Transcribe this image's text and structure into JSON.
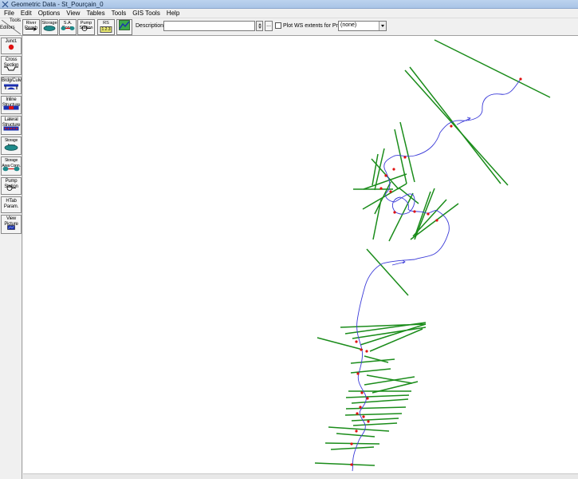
{
  "window": {
    "title": "Geometric Data - St_Pourçain_0"
  },
  "menu": [
    "File",
    "Edit",
    "Options",
    "View",
    "Tables",
    "Tools",
    "GIS Tools",
    "Help"
  ],
  "toolbar": {
    "tools_label": "Tools",
    "editors_label": "Editors",
    "river_reach_label": "River\nReach",
    "storage_area_label": "Storage\nArea",
    "sa_conn_label": "S.A.\nConn.",
    "pump_station_label": "Pump\nStation",
    "rs_label": "RS",
    "rs_badge": "1.2.3",
    "description_label": "Description :",
    "description_value": "",
    "dots_label": "...",
    "plot_ws_label": "Plot WS extents for Profile:",
    "profile_value": "(none)"
  },
  "palette": [
    {
      "key": "junct",
      "label": "Junct."
    },
    {
      "key": "cross_section",
      "label": "Cross\nSection"
    },
    {
      "key": "brdg_culv",
      "label": "Brdg/Culv"
    },
    {
      "key": "inline_structure",
      "label": "Inline\nStructure"
    },
    {
      "key": "lateral_structure",
      "label": "Lateral\nStructure"
    },
    {
      "key": "storage_area",
      "label": "Storage\nArea"
    },
    {
      "key": "storage_area_conn",
      "label": "Storage\nArea Conn."
    },
    {
      "key": "pump_station",
      "label": "Pump\nStation"
    },
    {
      "key": "htab_param",
      "label": "HTab\nParam."
    },
    {
      "key": "view_picture",
      "label": "View\nPicture"
    }
  ],
  "colors": {
    "river": "#3a3ad8",
    "cross_section": "#1a8c1a",
    "bank_station": "#e01010",
    "title_bar": "#b5cdeb"
  },
  "icons": [
    "app-icon",
    "river-reach-icon",
    "storage-area-icon",
    "sa-connection-icon",
    "pump-station-icon",
    "rs-icon",
    "gis-map-icon",
    "junction-icon",
    "cross-section-icon",
    "bridge-culvert-icon",
    "inline-structure-icon",
    "lateral-structure-icon",
    "storage-area-conn-icon",
    "htab-icon",
    "view-picture-icon"
  ]
}
